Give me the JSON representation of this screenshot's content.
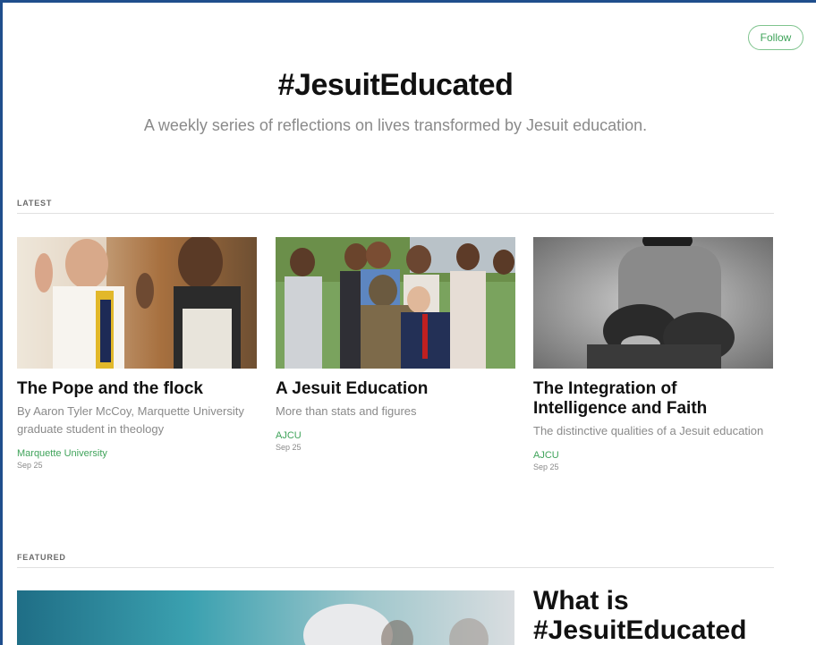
{
  "header": {
    "follow_label": "Follow"
  },
  "publication": {
    "title": "#JesuitEducated",
    "description": "A weekly series of reflections on lives transformed by Jesuit education."
  },
  "sections": {
    "latest_label": "LATEST",
    "featured_label": "FEATURED"
  },
  "latest": [
    {
      "title": "The Pope and the flock",
      "subtitle": "By Aaron Tyler McCoy, Marquette University graduate student in theology",
      "publisher": "Marquette University",
      "date": "Sep 25"
    },
    {
      "title": "A Jesuit Education",
      "subtitle": "More than stats and figures",
      "publisher": "AJCU",
      "date": "Sep 25"
    },
    {
      "title": "The Integration of Intelligence and Faith",
      "subtitle": "The distinctive qualities of a Jesuit education",
      "publisher": "AJCU",
      "date": "Sep 25"
    }
  ],
  "featured": {
    "title": "What is #JesuitEducated"
  },
  "colors": {
    "accent": "#3fa35a",
    "frame": "#1f4e8c"
  }
}
